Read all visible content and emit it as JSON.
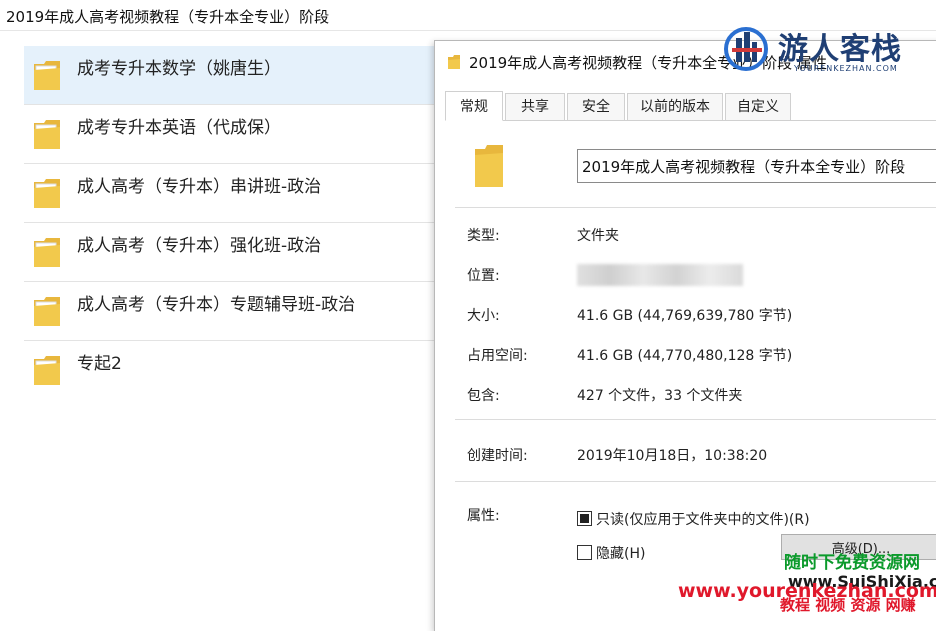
{
  "window": {
    "title": "2019年成人高考视频教程（专升本全专业）阶段"
  },
  "folders": [
    {
      "label": "成考专升本数学（姚唐生）",
      "selected": true
    },
    {
      "label": "成考专升本英语（代成保）",
      "selected": false
    },
    {
      "label": "成人高考（专升本）串讲班-政治",
      "selected": false
    },
    {
      "label": "成人高考（专升本）强化班-政治",
      "selected": false
    },
    {
      "label": "成人高考（专升本）专题辅导班-政治",
      "selected": false
    },
    {
      "label": "专起2",
      "selected": false
    }
  ],
  "dialog": {
    "title": "2019年成人高考视频教程（专升本全专业）阶段 属性",
    "tabs": [
      "常规",
      "共享",
      "安全",
      "以前的版本",
      "自定义"
    ],
    "active_tab": "常规",
    "name_value": "2019年成人高考视频教程（专升本全专业）阶段",
    "props": {
      "type_label": "类型:",
      "type_value": "文件夹",
      "location_label": "位置:",
      "size_label": "大小:",
      "size_value": "41.6 GB (44,769,639,780 字节)",
      "disk_label": "占用空间:",
      "disk_value": "41.6 GB (44,770,480,128 字节)",
      "contains_label": "包含:",
      "contains_value": "427 个文件，33 个文件夹",
      "created_label": "创建时间:",
      "created_value": "2019年10月18日，10:38:20",
      "attr_label": "属性:",
      "readonly_label": "只读(仅应用于文件夹中的文件)(R)",
      "hidden_label": "隐藏(H)",
      "advanced_label": "高级(D)..."
    }
  },
  "watermarks": {
    "logo_cn": "游人客栈",
    "logo_en": "YOURENKEZHAN.COM",
    "line1": "随时下免费资源网",
    "line2": "www.yourenkezhan.com",
    "line3": "www.SuiShiXia.com",
    "line4": "教程 视频 资源 网赚"
  },
  "colors": {
    "selection": "#e5f1fb",
    "folder_yellow": "#f2c94c",
    "logo_blue": "#1f3f74",
    "watermark_green": "#0b9a2b",
    "watermark_red": "#e0182b"
  }
}
